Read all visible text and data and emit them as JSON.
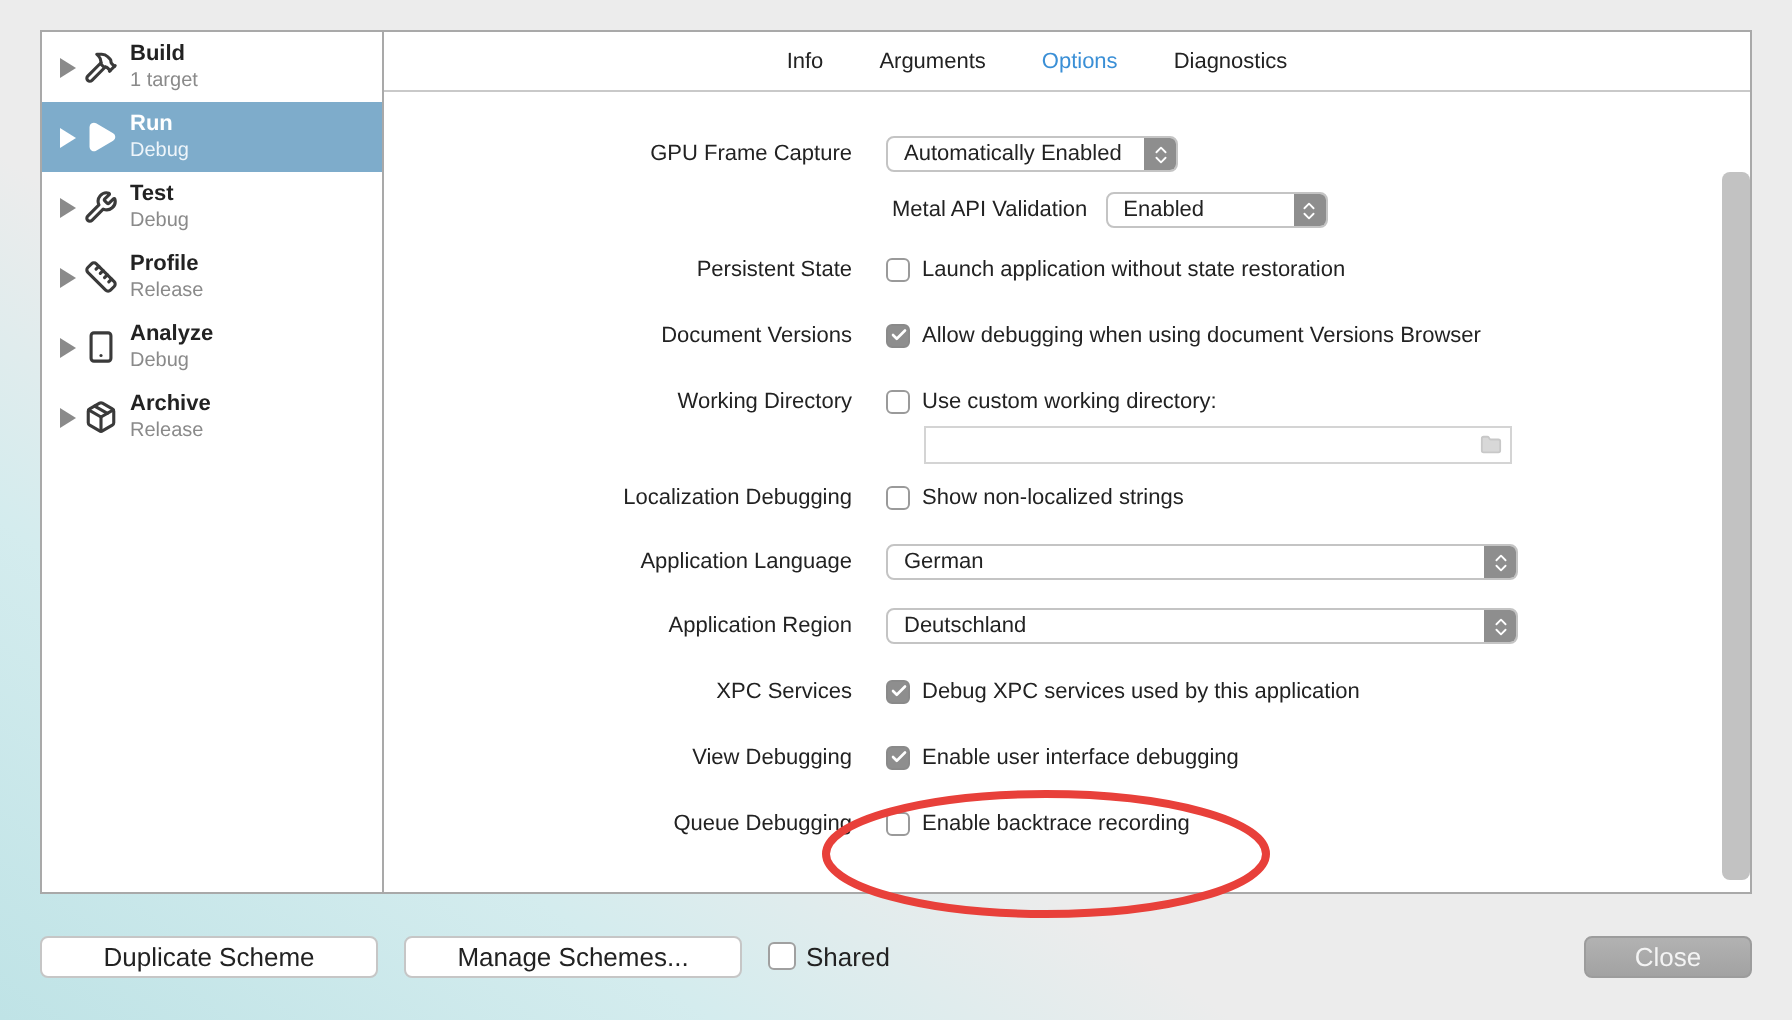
{
  "sidebar": {
    "items": [
      {
        "title": "Build",
        "subtitle": "1 target",
        "selected": false
      },
      {
        "title": "Run",
        "subtitle": "Debug",
        "selected": true
      },
      {
        "title": "Test",
        "subtitle": "Debug",
        "selected": false
      },
      {
        "title": "Profile",
        "subtitle": "Release",
        "selected": false
      },
      {
        "title": "Analyze",
        "subtitle": "Debug",
        "selected": false
      },
      {
        "title": "Archive",
        "subtitle": "Release",
        "selected": false
      }
    ]
  },
  "tabs": [
    {
      "label": "Info",
      "selected": false
    },
    {
      "label": "Arguments",
      "selected": false
    },
    {
      "label": "Options",
      "selected": true
    },
    {
      "label": "Diagnostics",
      "selected": false
    }
  ],
  "options": [
    {
      "kind": "compact_popup",
      "label": "GPU Frame Capture",
      "value": "Automatically Enabled"
    },
    {
      "kind": "subpopup",
      "label": "Metal API Validation",
      "value": "Enabled"
    },
    {
      "kind": "checkbox",
      "label": "Persistent State",
      "text": "Launch application without state restoration",
      "checked": false
    },
    {
      "kind": "checkbox",
      "label": "Document Versions",
      "text": "Allow debugging when using document Versions Browser",
      "checked": true
    },
    {
      "kind": "checkbox",
      "label": "Working Directory",
      "text": "Use custom working directory:",
      "checked": false
    },
    {
      "kind": "path"
    },
    {
      "kind": "checkbox",
      "label": "Localization Debugging",
      "text": "Show non-localized strings",
      "checked": false
    },
    {
      "kind": "popup",
      "label": "Application Language",
      "value": "German"
    },
    {
      "kind": "popup",
      "label": "Application Region",
      "value": "Deutschland"
    },
    {
      "kind": "checkbox",
      "label": "XPC Services",
      "text": "Debug XPC services used by this application",
      "checked": true
    },
    {
      "kind": "checkbox",
      "label": "View Debugging",
      "text": "Enable user interface debugging",
      "checked": true
    },
    {
      "kind": "checkbox",
      "label": "Queue Debugging",
      "text": "Enable backtrace recording",
      "checked": false
    }
  ],
  "footer": {
    "buttons": [
      {
        "label": "Duplicate Scheme"
      },
      {
        "label": "Manage Schemes..."
      }
    ],
    "shared": {
      "label": "Shared",
      "checked": false
    },
    "close": {
      "label": "Close",
      "disabled": true
    }
  }
}
